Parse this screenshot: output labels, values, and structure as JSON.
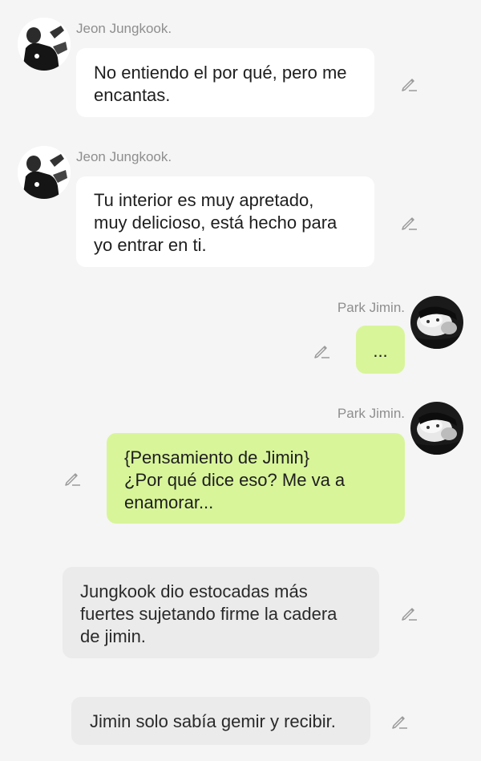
{
  "messages": [
    {
      "sender": "Jeon Jungkook.",
      "lines": [
        "No entiendo el por qué, pero me",
        "encantas."
      ]
    },
    {
      "sender": "Jeon Jungkook.",
      "lines": [
        "Tu interior es muy apretado,",
        "muy delicioso, está hecho para",
        "yo entrar en ti."
      ]
    },
    {
      "sender": "Park Jimin.",
      "lines": [
        "..."
      ]
    },
    {
      "sender": "Park Jimin.",
      "lines": [
        "{Pensamiento de Jimin}",
        "¿Por qué dice eso? Me va a",
        "enamorar..."
      ]
    }
  ],
  "narration": [
    {
      "lines": [
        "Jungkook dio estocadas más",
        "fuertes sujetando firme la cadera",
        "de jimin."
      ]
    },
    {
      "lines": [
        "Jimin solo sabía gemir y recibir."
      ]
    }
  ],
  "icons": {
    "edit": "pencil-icon",
    "avatar": "avatar-photo"
  },
  "colors": {
    "background": "#f5f5f5",
    "incoming": "#ffffff",
    "outgoing": "#d8f59a",
    "narration": "#ebebeb",
    "sender_name": "#8e8e8e"
  }
}
